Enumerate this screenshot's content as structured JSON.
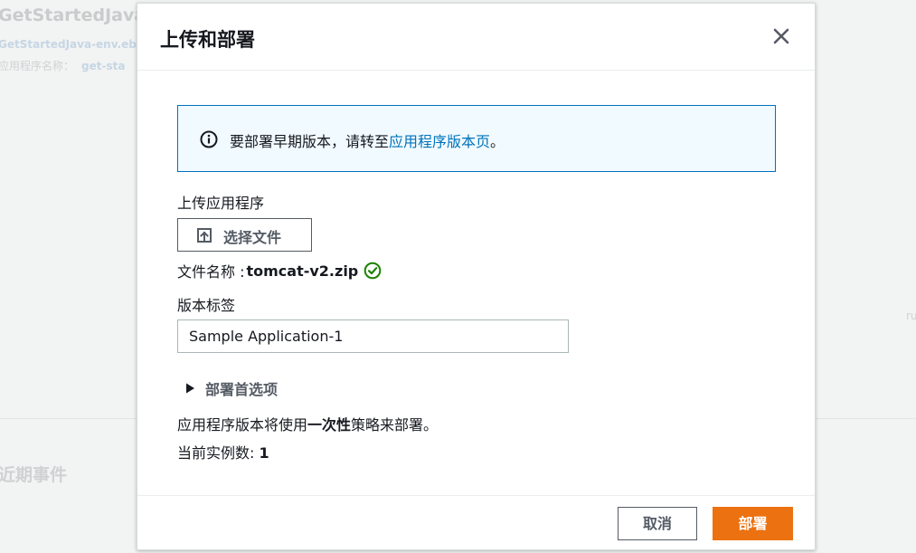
{
  "background": {
    "title": "GetStartedJava",
    "env_name": "GetStartedJava-env.eb",
    "app_name_label": "应用程序名称：",
    "app_name_value": "get-sta",
    "events_heading": "近期事件",
    "right_fragment": "ru"
  },
  "modal": {
    "title": "上传和部署",
    "close_icon": "close-icon",
    "info": {
      "icon": "info-icon",
      "text_before": "要部署早期版本，请转至",
      "link_text": "应用程序版本页",
      "text_after": "。",
      "border_color": "#0073bb",
      "bg_color": "#f1faff"
    },
    "upload": {
      "label": "上传应用程序",
      "button_label": "选择文件",
      "button_icon": "upload-icon",
      "filename_label": "文件名称 :",
      "filename_value": "tomcat-v2.zip",
      "status_icon": "check-circle-icon",
      "status_color": "#1d8102"
    },
    "version": {
      "label": "版本标签",
      "value": "Sample Application-1"
    },
    "preferences": {
      "label": "部署首选项",
      "expanded": false
    },
    "strategy": {
      "prefix": "应用程序版本将使用",
      "policy": "一次性",
      "suffix": "策略来部署。"
    },
    "instances": {
      "label": "当前实例数:",
      "value": "1"
    },
    "footer": {
      "cancel_label": "取消",
      "deploy_label": "部署",
      "deploy_color": "#ec7211"
    }
  }
}
